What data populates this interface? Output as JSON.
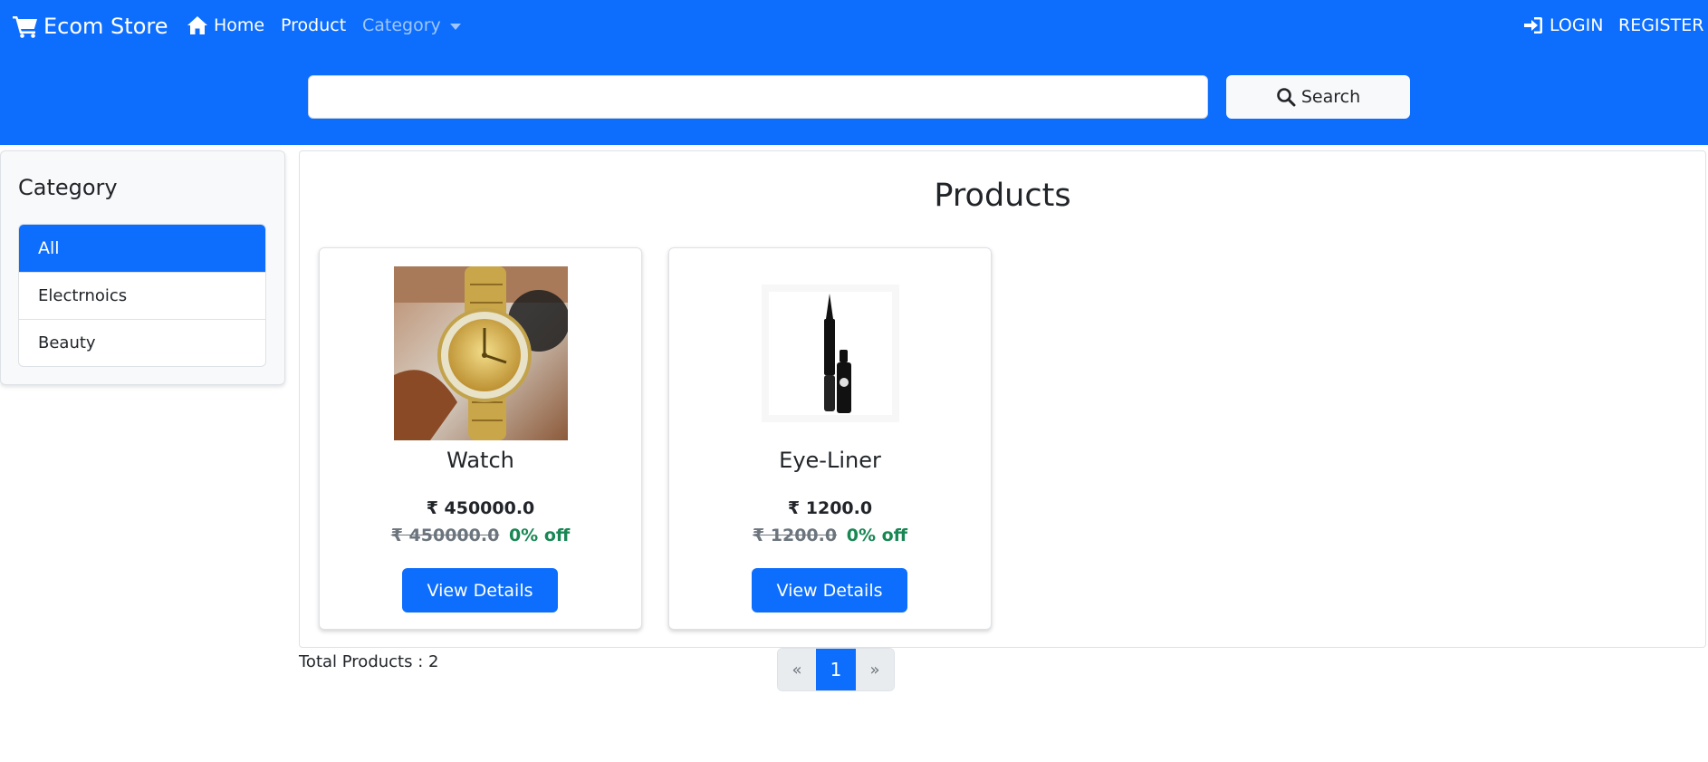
{
  "header": {
    "brand": "Ecom Store",
    "nav": {
      "home": "Home",
      "product": "Product",
      "category": "Category",
      "login": "LOGIN",
      "register": "REGISTER"
    },
    "search": {
      "placeholder": "",
      "value": "",
      "button_label": "Search"
    }
  },
  "sidebar": {
    "title": "Category",
    "items": [
      {
        "label": "All",
        "active": true
      },
      {
        "label": "Electrnoics",
        "active": false
      },
      {
        "label": "Beauty",
        "active": false
      }
    ]
  },
  "main": {
    "title": "Products",
    "products": [
      {
        "name": "Watch",
        "price": "₹ 450000.0",
        "original_price": "₹ 450000.0",
        "discount": "0% off",
        "button_label": "View Details",
        "image_icon": "gold-wristwatch"
      },
      {
        "name": "Eye-Liner",
        "price": "₹ 1200.0",
        "original_price": "₹ 1200.0",
        "discount": "0% off",
        "button_label": "View Details",
        "image_icon": "eyeliner-pen"
      }
    ],
    "total_text": "Total Products : 2",
    "pagination": {
      "prev": "«",
      "current": "1",
      "next": "»"
    }
  },
  "colors": {
    "primary": "#0d6efd",
    "success": "#198754",
    "muted": "#6c757d",
    "light": "#f8f9fa"
  }
}
